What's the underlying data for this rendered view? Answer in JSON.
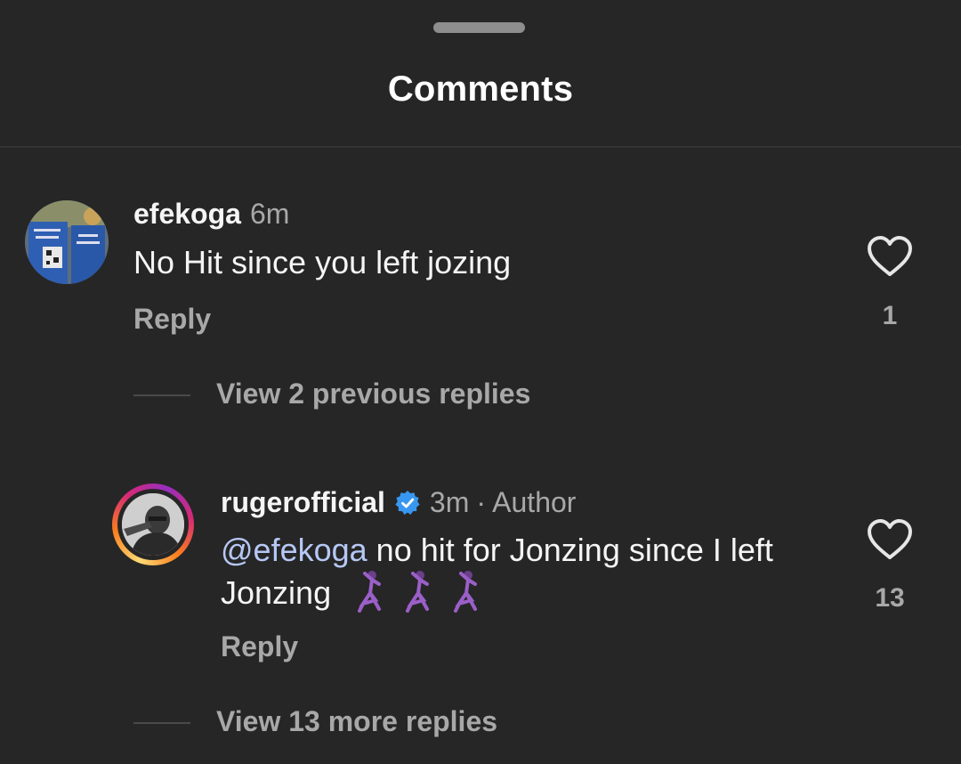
{
  "header": {
    "title": "Comments"
  },
  "comments": [
    {
      "username": "efekoga",
      "time": "6m",
      "text": "No Hit since you left jozing",
      "reply_label": "Reply",
      "likes": "1",
      "view_replies_label": "View 2 previous replies"
    },
    {
      "username": "rugerofficial",
      "verified": true,
      "time": "3m",
      "author_label": "· Author",
      "mention": "@efekoga",
      "text": "no hit for Jonzing since I left Jonzing",
      "emoji": [
        "dancing-woman",
        "dancing-woman",
        "dancing-woman"
      ],
      "reply_label": "Reply",
      "likes": "13",
      "view_replies_label": "View 13 more replies"
    }
  ],
  "colors": {
    "background": "#262626",
    "text": "#f5f5f5",
    "muted": "#a8a8a8",
    "mention": "#b6c8f5",
    "verified": "#3897f0"
  }
}
